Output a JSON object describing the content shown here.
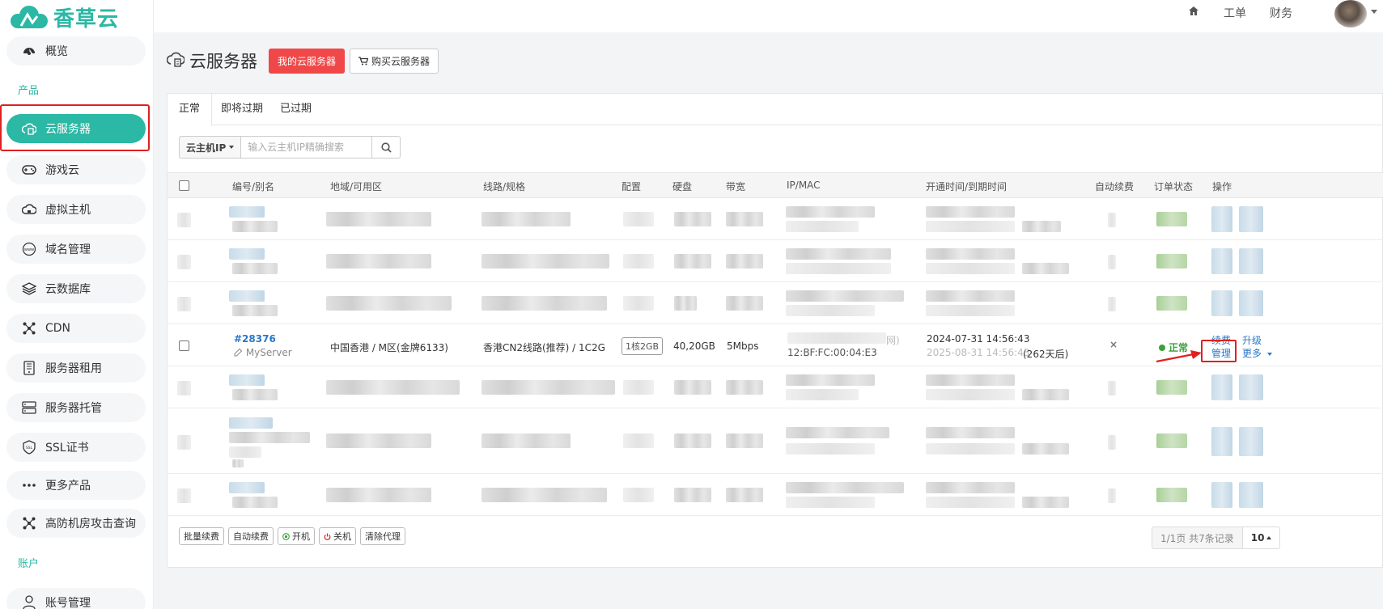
{
  "brand": {
    "name": "香草云",
    "color": "#2bb8a5"
  },
  "header": {
    "nav": [
      {
        "label": "工单"
      },
      {
        "label": "财务"
      }
    ]
  },
  "sidebar": {
    "items": [
      {
        "label": "概览",
        "icon": "dashboard-icon"
      },
      {
        "label": "云服务器",
        "icon": "cloud-server-icon",
        "active": true
      },
      {
        "label": "游戏云",
        "icon": "gamepad-icon"
      },
      {
        "label": "虚拟主机",
        "icon": "virtual-host-icon"
      },
      {
        "label": "域名管理",
        "icon": "www-icon"
      },
      {
        "label": "云数据库",
        "icon": "layers-icon"
      },
      {
        "label": "CDN",
        "icon": "cdn-icon"
      },
      {
        "label": "服务器租用",
        "icon": "server-icon"
      },
      {
        "label": "服务器托管",
        "icon": "rack-icon"
      },
      {
        "label": "SSL证书",
        "icon": "ssl-shield-icon"
      },
      {
        "label": "更多产品",
        "icon": "more-dots-icon"
      },
      {
        "label": "高防机房攻击查询",
        "icon": "network-icon"
      },
      {
        "label": "账号管理",
        "icon": "user-icon"
      }
    ],
    "groups": {
      "products": "产品",
      "account": "账户"
    }
  },
  "page": {
    "title": "云服务器",
    "my_servers_button": "我的云服务器",
    "buy_button": "购买云服务器"
  },
  "tabs": [
    {
      "label": "正常",
      "active": true
    },
    {
      "label": "即将过期"
    },
    {
      "label": "已过期"
    }
  ],
  "search": {
    "select_label": "云主机IP",
    "placeholder": "输入云主机IP精确搜索"
  },
  "table": {
    "headers": [
      "编号/别名",
      "地域/可用区",
      "线路/规格",
      "配置",
      "硬盘",
      "带宽",
      "IP/MAC",
      "开通时间/到期时间",
      "自动续费",
      "订单状态",
      "操作"
    ],
    "visible_row": {
      "id": "#28376",
      "alias": "MyServer",
      "region": "中国香港 / M区(金牌6133)",
      "line": "香港CN2线路(推荐) / 1C2G",
      "config": "1核2GB",
      "disk": "40,20GB",
      "bandwidth": "5Mbps",
      "ip_suffix": "网)",
      "mac": "12:BF:FC:00:04:E3",
      "open_time": "2024-07-31 14:56:43",
      "expire_time": "2025-08-31 14:56:43",
      "remaining": "(262天后)",
      "auto_renew": "×",
      "status": "正常",
      "actions": {
        "renew": "续费",
        "upgrade": "升级",
        "manage": "管理",
        "more": "更多"
      }
    }
  },
  "footer": {
    "buttons": [
      {
        "label": "批量续费"
      },
      {
        "label": "自动续费"
      },
      {
        "label": "开机"
      },
      {
        "label": "关机"
      },
      {
        "label": "清除代理"
      }
    ],
    "pager_info": "1/1页 共7条记录",
    "page_size": "10"
  }
}
